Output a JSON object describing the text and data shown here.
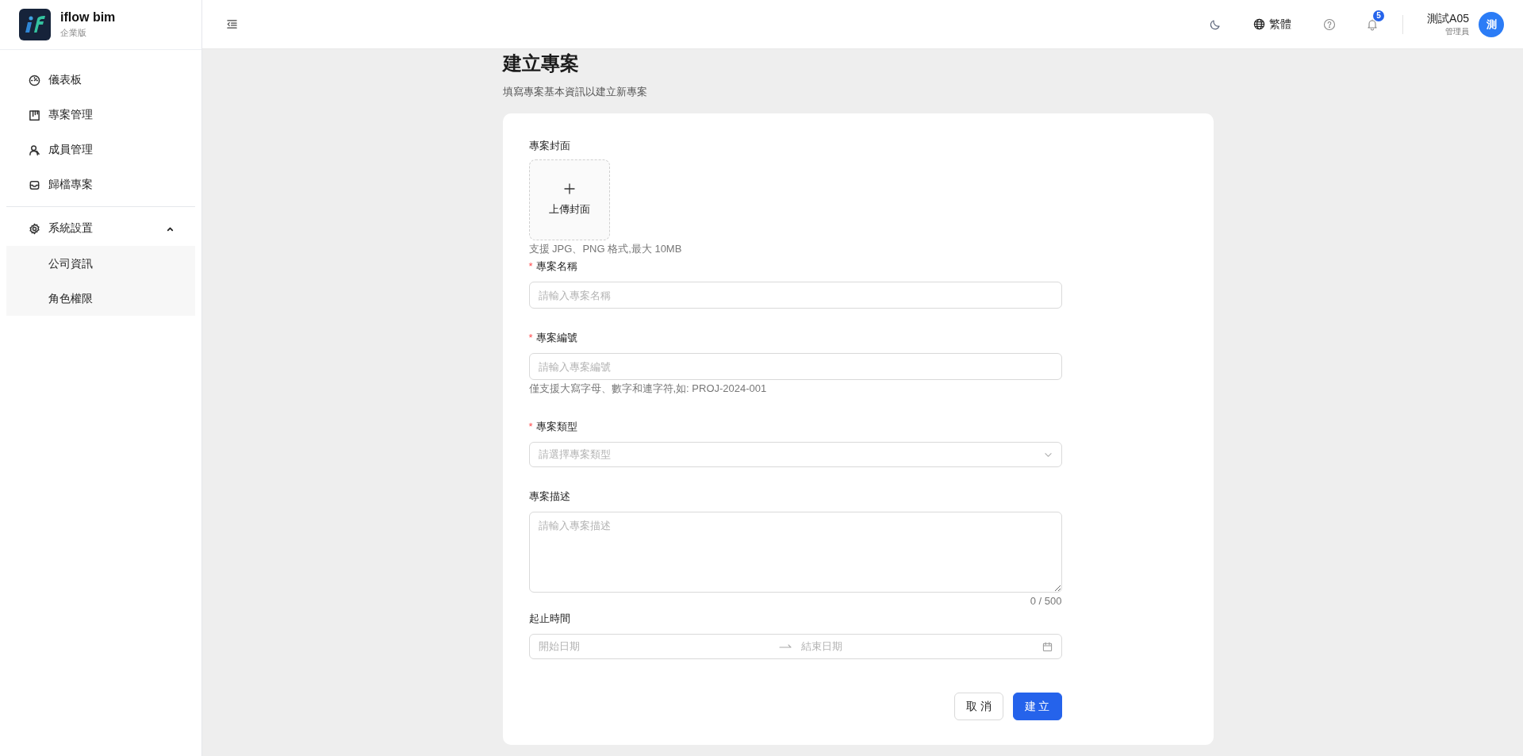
{
  "app": {
    "name": "iflow bim",
    "edition": "企業版"
  },
  "header": {
    "language": "繁體",
    "notification_count": "5",
    "user": {
      "name": "測試A05",
      "role": "管理員",
      "avatar": "測"
    }
  },
  "sidebar": {
    "items": [
      {
        "label": "儀表板"
      },
      {
        "label": "專案管理"
      },
      {
        "label": "成員管理"
      },
      {
        "label": "歸檔專案"
      }
    ],
    "group": {
      "label": "系統設置",
      "expanded": true,
      "children": [
        {
          "label": "公司資訊"
        },
        {
          "label": "角色權限"
        }
      ]
    }
  },
  "page": {
    "title": "建立專案",
    "subtitle": "填寫專案基本資訊以建立新專案"
  },
  "form": {
    "fields": [
      {
        "kind": "upload",
        "label": "專案封面",
        "button": "上傳封面",
        "hint": "支援 JPG、PNG 格式,最大 10MB"
      },
      {
        "kind": "text",
        "label": "專案名稱",
        "required_mark": "*",
        "placeholder": "請輸入專案名稱"
      },
      {
        "kind": "text",
        "label": "專案編號",
        "required_mark": "*",
        "placeholder": "請輸入專案編號",
        "hint": "僅支援大寫字母、數字和連字符,如: PROJ-2024-001"
      },
      {
        "kind": "select",
        "label": "專案類型",
        "required_mark": "*",
        "placeholder": "請選擇專案類型"
      },
      {
        "kind": "textarea",
        "label": "專案描述",
        "placeholder": "請輸入專案描述",
        "counter": "0 / 500"
      },
      {
        "kind": "daterange",
        "label": "起止時間",
        "start_placeholder": "開始日期",
        "end_placeholder": "結束日期"
      }
    ],
    "buttons": [
      {
        "label": "取 消",
        "kind": "default"
      },
      {
        "label": "建 立",
        "kind": "primary"
      }
    ]
  }
}
